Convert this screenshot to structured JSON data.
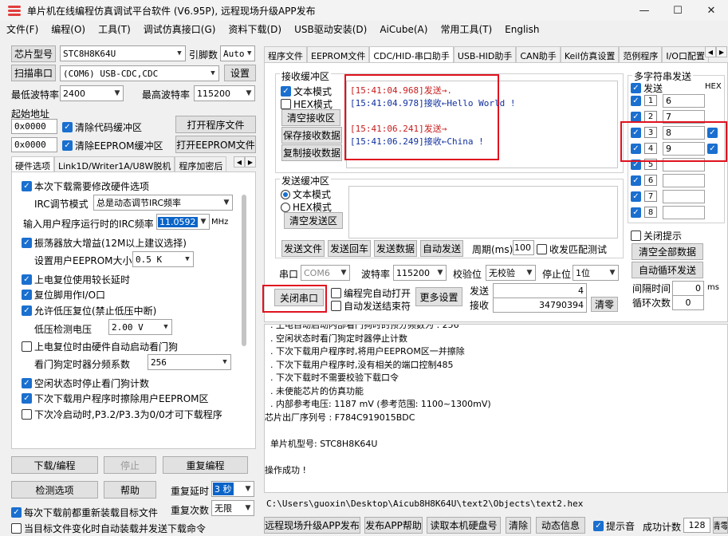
{
  "window": {
    "title": "单片机在线编程仿真调试平台软件 (V6.95P), 远程现场升级APP发布"
  },
  "menu": [
    "文件(F)",
    "编程(O)",
    "工具(T)",
    "调试仿真接口(G)",
    "资料下载(D)",
    "USB驱动安装(D)",
    "AiCube(A)",
    "常用工具(T)",
    "English"
  ],
  "left": {
    "chip_label": "芯片型号",
    "chip_value": "STC8H8K64U",
    "pins_label": "引脚数",
    "pins_value": "Auto",
    "scan_label": "扫描串口",
    "port_value": "(COM6) USB-CDC,CDC",
    "settings_label": "设置",
    "min_baud_label": "最低波特率",
    "min_baud_value": "2400",
    "max_baud_label": "最高波特率",
    "max_baud_value": "115200",
    "start_addr_label": "起始地址",
    "addr1": "0x0000",
    "clear_code_label": "清除代码缓冲区",
    "open_prog_label": "打开程序文件",
    "addr2": "0x0000",
    "clear_eeprom_label": "清除EEPROM缓冲区",
    "open_eeprom_label": "打开EEPROM文件",
    "tabs": [
      "硬件选项",
      "Link1D/Writer1A/U8W脱机",
      "程序加密后"
    ],
    "hw": {
      "opt1": "本次下载需要修改硬件选项",
      "irc_mode_label": "IRC调节模式",
      "irc_mode_value": "总是动态调节IRC频率",
      "freq_label": "输入用户程序运行时的IRC频率",
      "freq_value": "11.0592",
      "freq_unit": "MHz",
      "opt2": "振荡器放大增益(12M以上建议选择)",
      "eeprom_size_label": "设置用户EEPROM大小",
      "eeprom_size_value": "0.5 K",
      "opt3": "上电复位使用较长延时",
      "opt4": "复位脚用作I/O口",
      "opt5": "允许低压复位(禁止低压中断)",
      "lv_label": "低压检测电压",
      "lv_value": "2.00 V",
      "opt6": "上电复位时由硬件自动启动看门狗",
      "wdt_label": "看门狗定时器分频系数",
      "wdt_value": "256",
      "opt7": "空闲状态时停止看门狗计数",
      "opt8": "下次下载用户程序时擦除用户EEPROM区",
      "opt9": "下次冷启动时,P3.2/P3.3为0/0才可下载程序"
    },
    "download_label": "下载/编程",
    "stop_label": "停止",
    "reprogram_label": "重复编程",
    "check_label": "检测选项",
    "help_label": "帮助",
    "repeat_delay_label": "重复延时",
    "repeat_delay_value": "3 秒",
    "reload_label": "每次下载前都重新装载目标文件",
    "repeat_count_label": "重复次数",
    "repeat_count_value": "无限",
    "auto_load_label": "当目标文件变化时自动装载并发送下载命令"
  },
  "right": {
    "tabs": [
      "程序文件",
      "EEPROM文件",
      "CDC/HID-串口助手",
      "USB-HID助手",
      "CAN助手",
      "Keil仿真设置",
      "范例程序",
      "I/O口配置"
    ],
    "recv_title": "接收缓冲区",
    "text_mode": "文本模式",
    "hex_mode": "HEX模式",
    "clear_recv": "清空接收区",
    "save_recv": "保存接收数据",
    "copy_recv": "复制接收数据",
    "log": [
      {
        "time": "[15:41:04.968]",
        "dir": "发送→",
        "msg": ".",
        "color": "#c81d1d"
      },
      {
        "time": "[15:41:04.978]",
        "dir": "接收←",
        "msg": "Hello World !",
        "color": "#1030a0"
      },
      {
        "time": "",
        "dir": "",
        "msg": "",
        "color": "#000"
      },
      {
        "time": "[15:41:06.241]",
        "dir": "发送→",
        "msg": "",
        "color": "#c81d1d"
      },
      {
        "time": "[15:41:06.249]",
        "dir": "接收←",
        "msg": "China !",
        "color": "#1030a0"
      }
    ],
    "send_title": "发送缓冲区",
    "clear_send": "清空发送区",
    "send_file": "发送文件",
    "send_cr": "发送回车",
    "send_data": "发送数据",
    "auto_send": "自动发送",
    "period_label": "周期(ms)",
    "period_value": "100",
    "match_label": "收发匹配测试",
    "port_label": "串口",
    "port_value": "COM6",
    "baud_label": "波特率",
    "baud_value": "115200",
    "parity_label": "校验位",
    "parity_value": "无校验",
    "stopbit_label": "停止位",
    "stopbit_value": "1位",
    "close_port": "关闭串口",
    "auto_open": "编程完自动打开",
    "auto_end": "自动发送结束符",
    "more_settings": "更多设置",
    "sent_label": "发送",
    "sent_value": "4",
    "recv_label": "接收",
    "recv_value": "34790394",
    "reset_label": "清零",
    "multi": {
      "title": "多字符串发送",
      "send_col": "发送",
      "hex_col": "HEX",
      "rows": [
        {
          "n": "1",
          "v": "6"
        },
        {
          "n": "2",
          "v": "7"
        },
        {
          "n": "3",
          "v": "8"
        },
        {
          "n": "4",
          "v": "9"
        },
        {
          "n": "5",
          "v": ""
        },
        {
          "n": "6",
          "v": ""
        },
        {
          "n": "7",
          "v": ""
        },
        {
          "n": "8",
          "v": ""
        }
      ],
      "close_tip": "关闭提示",
      "clear_all": "清空全部数据",
      "auto_loop": "自动循环发送",
      "interval_label": "间隔时间",
      "interval_value": "0",
      "interval_unit": "ms",
      "loop_label": "循环次数",
      "loop_value": "0"
    }
  },
  "output": {
    "lines": [
      "  . 上电自动启动内部看门狗时的预分频数为 : 256",
      "  . 空闲状态时看门狗定时器停止计数",
      "  . 下次下载用户程序时,将用户EEPROM区一并擦除",
      "  . 下次下载用户程序时,没有相关的端口控制485",
      "  . 下次下载时不需要校验下载口令",
      "  . 未使能芯片的仿真功能",
      "  . 内部参考电压: 1187 mV (参考范围: 1100~1300mV)",
      "芯片出厂序列号 : F784C919015BDC",
      "",
      "  单片机型号: STC8H8K64U",
      "",
      "操作成功 !"
    ],
    "path": "C:\\Users\\guoxin\\Desktop\\Aicub8H8K64U\\text2\\Objects\\text2.hex"
  },
  "bottom": {
    "remote": "远程现场升级APP发布",
    "help": "发布APP帮助",
    "read_disk": "读取本机硬盘号",
    "clear": "清除",
    "dynamic": "动态信息",
    "beep": "提示音",
    "success_label": "成功计数",
    "success_value": "128",
    "reset": "清零"
  }
}
